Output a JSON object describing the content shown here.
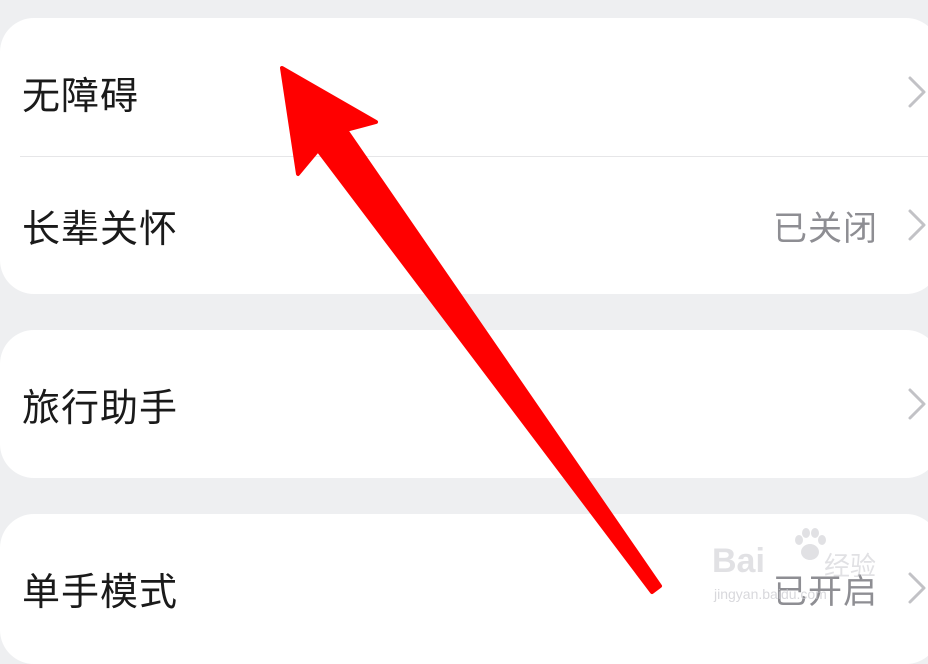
{
  "settings": {
    "group1": {
      "accessibility": {
        "label": "无障碍"
      },
      "elder_care": {
        "label": "长辈关怀",
        "value": "已关闭"
      }
    },
    "group2": {
      "travel_assistant": {
        "label": "旅行助手"
      }
    },
    "group3": {
      "one_hand_mode": {
        "label": "单手模式",
        "value": "已开启"
      }
    }
  },
  "watermark": {
    "brand": "Bai",
    "suffix": "经验",
    "url": "jingyan.baidu.com"
  },
  "colors": {
    "page_background": "#eeeff1",
    "card_background": "#ffffff",
    "label_text": "#1a1a1a",
    "value_text": "#8e8e93",
    "annotation_arrow": "#ff0000"
  },
  "icons": {
    "row_chevron": "chevron-right-icon",
    "annotation": "red-arrow-annotation",
    "watermark_logo": "paw-logo-icon"
  }
}
